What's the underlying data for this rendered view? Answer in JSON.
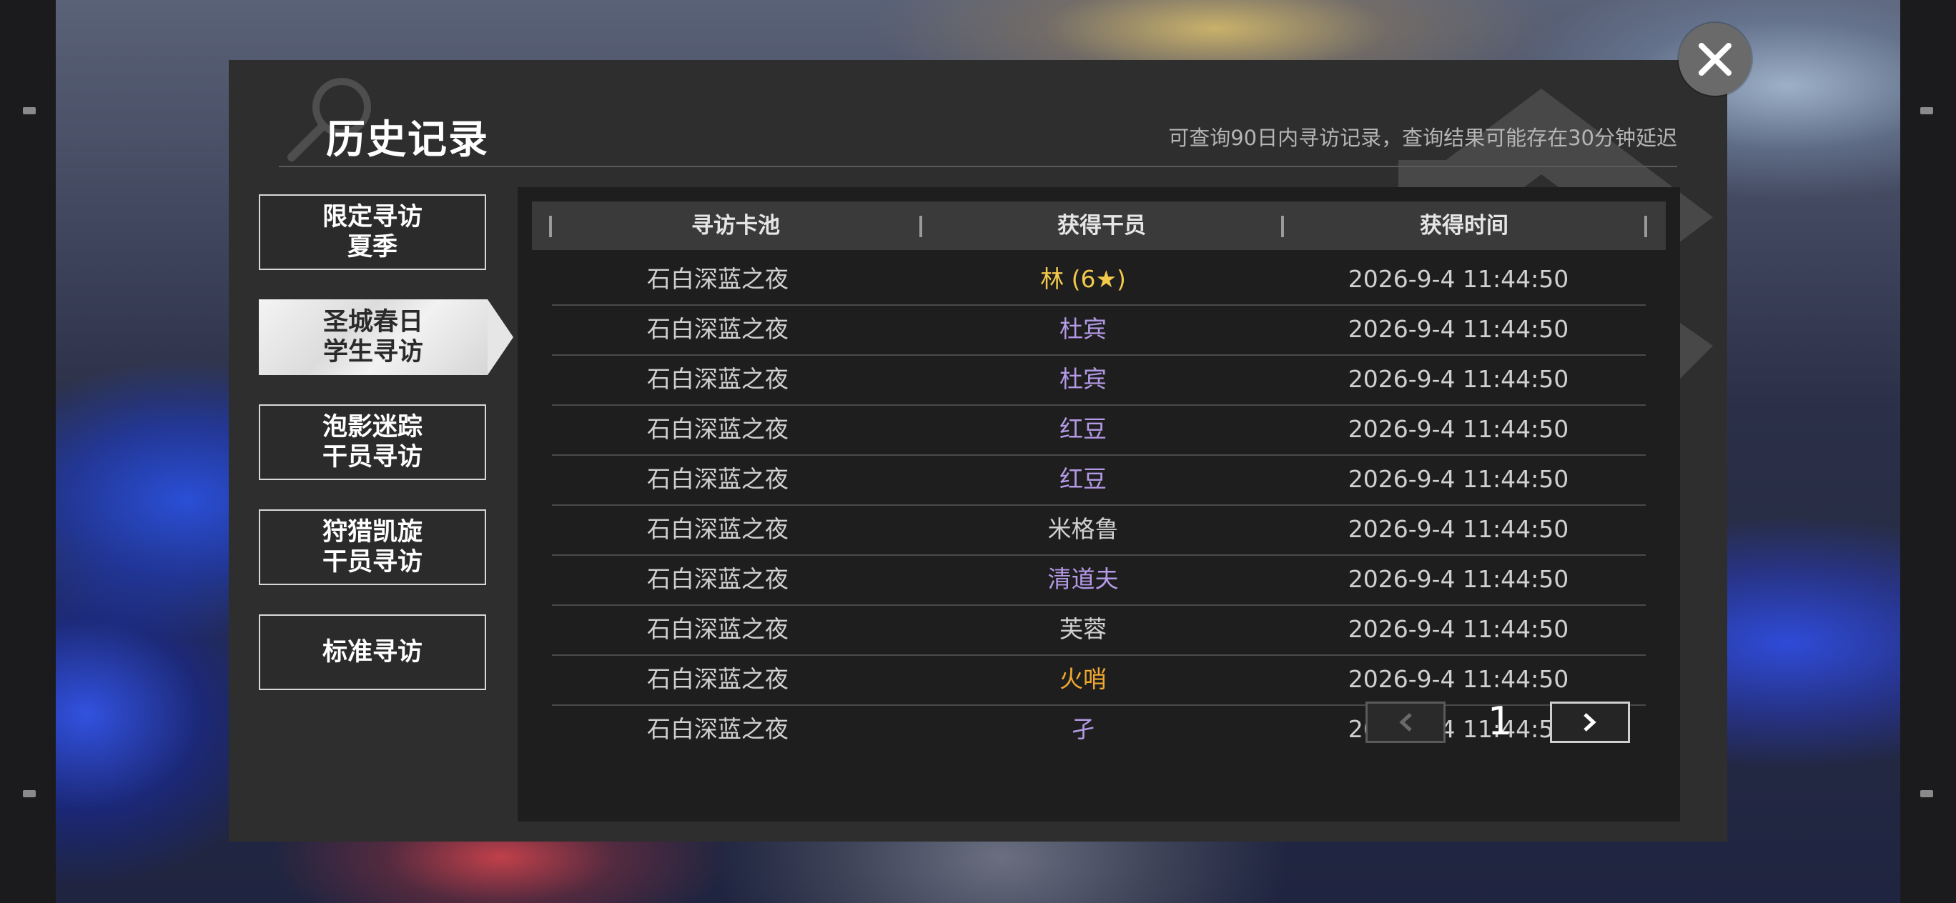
{
  "panel": {
    "title": "历史记录",
    "subtitle": "可查询90日内寻访记录，查询结果可能存在30分钟延迟"
  },
  "tabs": [
    {
      "line1": "限定寻访",
      "line2": "夏季",
      "active": false
    },
    {
      "line1": "圣城春日",
      "line2": "学生寻访",
      "active": true
    },
    {
      "line1": "泡影迷踪",
      "line2": "干员寻访",
      "active": false
    },
    {
      "line1": "狩猎凯旋",
      "line2": "干员寻访",
      "active": false
    },
    {
      "line1": "标准寻访",
      "line2": "",
      "active": false
    }
  ],
  "table": {
    "headers": [
      "寻访卡池",
      "获得干员",
      "获得时间"
    ],
    "rows": [
      {
        "pool": "石白深蓝之夜",
        "operator": "林 (6★)",
        "time": "2026-9-4 11:44:50",
        "color": "#f2c94c"
      },
      {
        "pool": "石白深蓝之夜",
        "operator": "杜宾",
        "time": "2026-9-4 11:44:50",
        "color": "#b49ae6"
      },
      {
        "pool": "石白深蓝之夜",
        "operator": "杜宾",
        "time": "2026-9-4 11:44:50",
        "color": "#b49ae6"
      },
      {
        "pool": "石白深蓝之夜",
        "operator": "红豆",
        "time": "2026-9-4 11:44:50",
        "color": "#b49ae6"
      },
      {
        "pool": "石白深蓝之夜",
        "operator": "红豆",
        "time": "2026-9-4 11:44:50",
        "color": "#b49ae6"
      },
      {
        "pool": "石白深蓝之夜",
        "operator": "米格鲁",
        "time": "2026-9-4 11:44:50",
        "color": "#d0d0d0"
      },
      {
        "pool": "石白深蓝之夜",
        "operator": "清道夫",
        "time": "2026-9-4 11:44:50",
        "color": "#b49ae6"
      },
      {
        "pool": "石白深蓝之夜",
        "operator": "芙蓉",
        "time": "2026-9-4 11:44:50",
        "color": "#d0d0d0"
      },
      {
        "pool": "石白深蓝之夜",
        "operator": "火哨",
        "time": "2026-9-4 11:44:50",
        "color": "#f0a830"
      },
      {
        "pool": "石白深蓝之夜",
        "operator": "孑",
        "time": "2026-9-4 11:44:50",
        "color": "#b49ae6"
      }
    ]
  },
  "pagination": {
    "page": "1"
  },
  "icons": {
    "close": "close-icon",
    "prev": "chevron-left-icon",
    "next": "chevron-right-icon",
    "search": "search-icon"
  }
}
